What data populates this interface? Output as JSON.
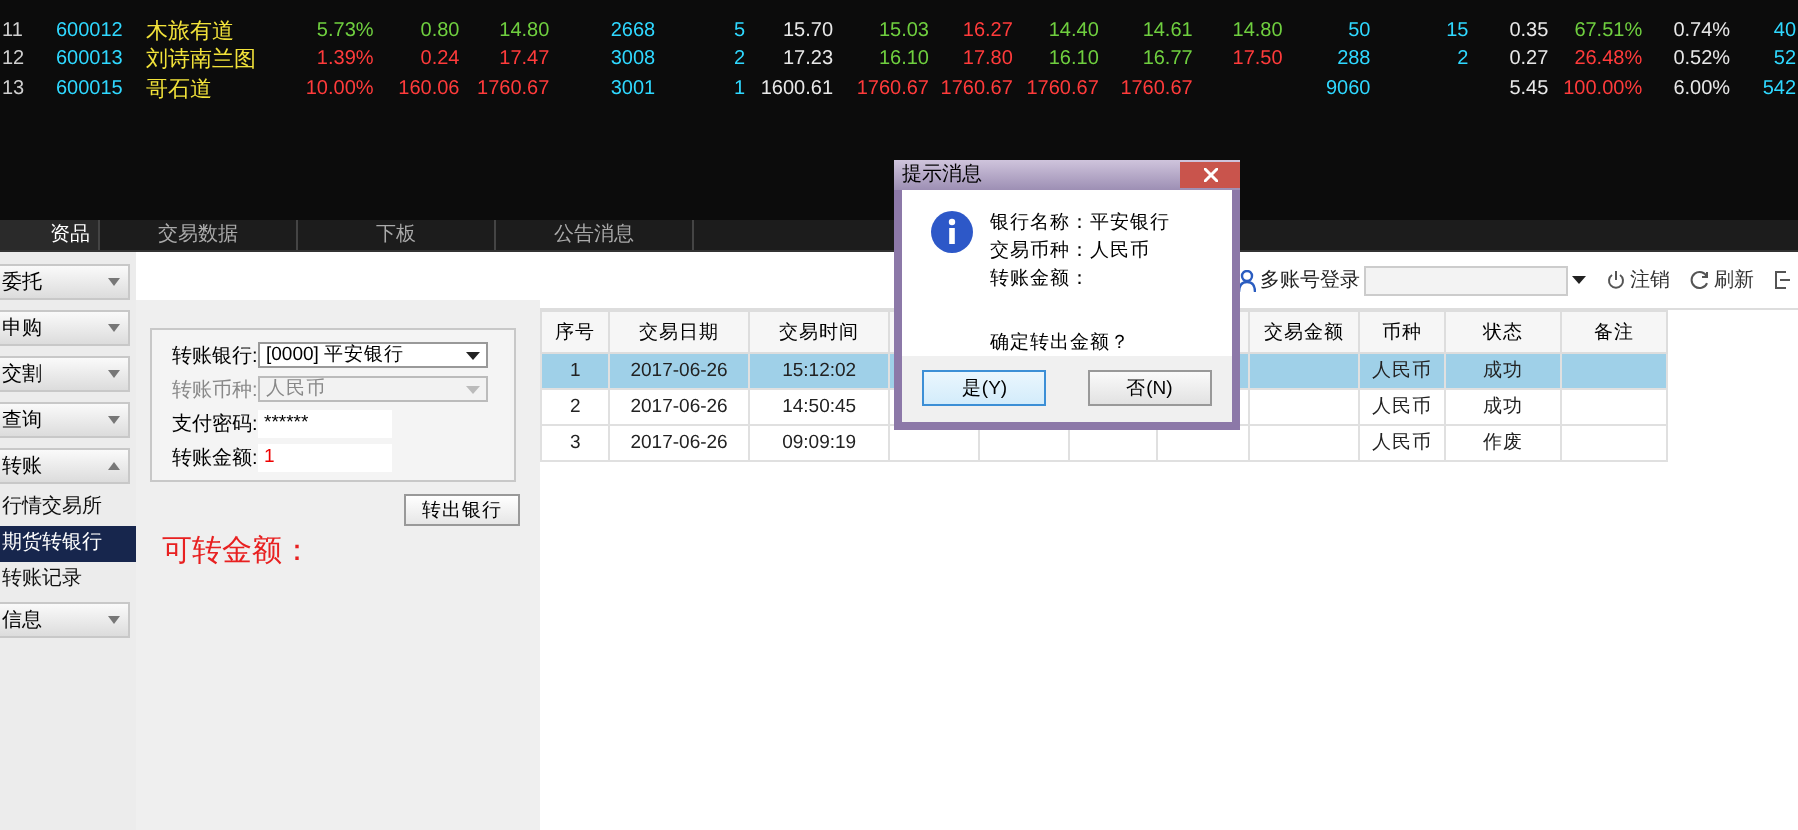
{
  "quotes": [
    {
      "index": "11",
      "code": "600012",
      "name": "木旅有道",
      "cells": [
        {
          "kind": "value",
          "text": "5.73%",
          "color": "#6fcf3f"
        },
        {
          "kind": "value",
          "text": "0.80",
          "color": "#6fcf3f"
        },
        {
          "kind": "value",
          "text": "14.80",
          "color": "#6fcf3f"
        },
        {
          "kind": "value",
          "text": "2668",
          "color": "#2fd8ff"
        },
        {
          "kind": "value",
          "text": "5",
          "color": "#2fd8ff"
        },
        {
          "kind": "value",
          "text": "15.70",
          "color": "#e8e8e8"
        },
        {
          "kind": "value",
          "text": "15.03",
          "color": "#6fcf3f"
        },
        {
          "kind": "value",
          "text": "16.27",
          "color": "#ff3b3b"
        },
        {
          "kind": "value",
          "text": "14.40",
          "color": "#6fcf3f"
        },
        {
          "kind": "value",
          "text": "14.61",
          "color": "#6fcf3f"
        },
        {
          "kind": "value",
          "text": "14.80",
          "color": "#6fcf3f"
        },
        {
          "kind": "value",
          "text": "50",
          "color": "#2fd8ff"
        },
        {
          "kind": "value",
          "text": "15",
          "color": "#2fd8ff"
        },
        {
          "kind": "value",
          "text": "0.35",
          "color": "#e8e8e8"
        },
        {
          "kind": "value",
          "text": "67.51%",
          "color": "#6fcf3f"
        },
        {
          "kind": "value",
          "text": "0.74%",
          "color": "#e8e8e8"
        },
        {
          "kind": "value",
          "text": "40",
          "color": "#2fd8ff"
        }
      ]
    },
    {
      "index": "12",
      "code": "600013",
      "name": "刘诗南兰图",
      "cells": [
        {
          "kind": "value",
          "text": "1.39%",
          "color": "#ff3b3b"
        },
        {
          "kind": "value",
          "text": "0.24",
          "color": "#ff3b3b"
        },
        {
          "kind": "value",
          "text": "17.47",
          "color": "#ff3b3b"
        },
        {
          "kind": "value",
          "text": "3008",
          "color": "#2fd8ff"
        },
        {
          "kind": "value",
          "text": "2",
          "color": "#2fd8ff"
        },
        {
          "kind": "value",
          "text": "17.23",
          "color": "#e8e8e8"
        },
        {
          "kind": "value",
          "text": "16.10",
          "color": "#6fcf3f"
        },
        {
          "kind": "value",
          "text": "17.80",
          "color": "#ff3b3b"
        },
        {
          "kind": "value",
          "text": "16.10",
          "color": "#6fcf3f"
        },
        {
          "kind": "value",
          "text": "16.77",
          "color": "#6fcf3f"
        },
        {
          "kind": "value",
          "text": "17.50",
          "color": "#ff3b3b"
        },
        {
          "kind": "value",
          "text": "288",
          "color": "#2fd8ff"
        },
        {
          "kind": "value",
          "text": "2",
          "color": "#2fd8ff"
        },
        {
          "kind": "value",
          "text": "0.27",
          "color": "#e8e8e8"
        },
        {
          "kind": "value",
          "text": "26.48%",
          "color": "#ff3b3b"
        },
        {
          "kind": "value",
          "text": "0.52%",
          "color": "#e8e8e8"
        },
        {
          "kind": "value",
          "text": "52",
          "color": "#2fd8ff"
        }
      ]
    },
    {
      "index": "13",
      "code": "600015",
      "name": "哥石道",
      "cells": [
        {
          "kind": "value",
          "text": "10.00%",
          "color": "#ff3b3b"
        },
        {
          "kind": "value",
          "text": "160.06",
          "color": "#ff3b3b"
        },
        {
          "kind": "value",
          "text": "1760.67",
          "color": "#ff3b3b"
        },
        {
          "kind": "value",
          "text": "3001",
          "color": "#2fd8ff"
        },
        {
          "kind": "value",
          "text": "1",
          "color": "#2fd8ff"
        },
        {
          "kind": "value",
          "text": "1600.61",
          "color": "#e8e8e8"
        },
        {
          "kind": "value",
          "text": "1760.67",
          "color": "#ff3b3b"
        },
        {
          "kind": "value",
          "text": "1760.67",
          "color": "#ff3b3b"
        },
        {
          "kind": "value",
          "text": "1760.67",
          "color": "#ff3b3b"
        },
        {
          "kind": "value",
          "text": "1760.67",
          "color": "#ff3b3b"
        },
        {
          "kind": "empty"
        },
        {
          "kind": "value",
          "text": "9060",
          "color": "#2fd8ff"
        },
        {
          "kind": "empty"
        },
        {
          "kind": "value",
          "text": "5.45",
          "color": "#e8e8e8"
        },
        {
          "kind": "value",
          "text": "100.00%",
          "color": "#ff3b3b"
        },
        {
          "kind": "value",
          "text": "6.00%",
          "color": "#e8e8e8"
        },
        {
          "kind": "value",
          "text": "542",
          "color": "#2fd8ff"
        }
      ]
    }
  ],
  "tabs": [
    {
      "label": "资品",
      "selected": true
    },
    {
      "label": "交易数据",
      "selected": false
    },
    {
      "label": "下板",
      "selected": false
    },
    {
      "label": "公告消息",
      "selected": false
    }
  ],
  "sidebar": {
    "items": [
      {
        "label": "委托",
        "expanded": false
      },
      {
        "label": "申购",
        "expanded": false
      },
      {
        "label": "交割",
        "expanded": false
      },
      {
        "label": "查询",
        "expanded": false
      },
      {
        "label": "转账",
        "expanded": true,
        "children": [
          {
            "label": "行情交易所",
            "selected": false
          },
          {
            "label": "期货转银行",
            "selected": true
          },
          {
            "label": "转账记录",
            "selected": false
          }
        ]
      },
      {
        "label": "信息",
        "expanded": false
      }
    ]
  },
  "form": {
    "fields": [
      {
        "kind": "select",
        "label": "转账银行:",
        "value": "[0000] 平安银行",
        "disabled": false
      },
      {
        "kind": "select",
        "label": "转账币种:",
        "value": "人民币",
        "disabled": true
      },
      {
        "kind": "password",
        "label": "支付密码:",
        "value": "******"
      },
      {
        "kind": "amount",
        "label": "转账金额:",
        "value": "1"
      }
    ],
    "submit": "转出银行",
    "available_label": "可转金额："
  },
  "toolbar": {
    "account_label": "多账号登录",
    "buttons": [
      "注销",
      "刷新"
    ]
  },
  "table": {
    "columns": [
      "序号",
      "交易日期",
      "交易时间",
      "交易金额",
      "币种",
      "状态",
      "备注"
    ],
    "rows": [
      {
        "selected": true,
        "cells": [
          "1",
          "2017-06-26",
          "15:12:02",
          "",
          "人民币",
          "成功",
          ""
        ]
      },
      {
        "selected": false,
        "cells": [
          "2",
          "2017-06-26",
          "14:50:45",
          "",
          "人民币",
          "成功",
          ""
        ]
      },
      {
        "selected": false,
        "cells": [
          "3",
          "2017-06-26",
          "09:09:19",
          "",
          "人民币",
          "作废",
          ""
        ]
      }
    ]
  },
  "dialog": {
    "title": "提示消息",
    "lines": [
      "银行名称：平安银行",
      "交易币种：人民币",
      "转账金额："
    ],
    "question": "确定转出金额？",
    "buttons": [
      {
        "label": "是(Y)",
        "focused": true
      },
      {
        "label": "否(N)",
        "focused": false
      }
    ]
  }
}
